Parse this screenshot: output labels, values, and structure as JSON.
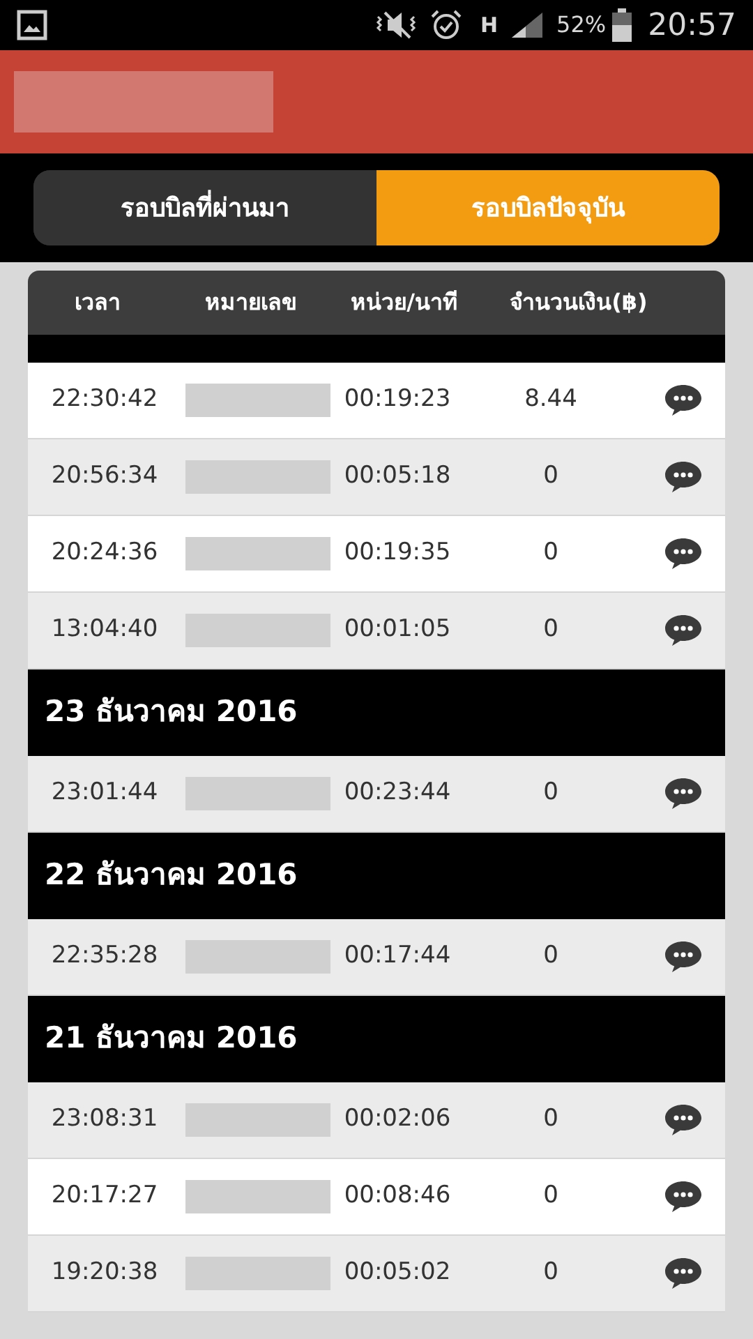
{
  "status_bar": {
    "network": "H",
    "battery": "52%",
    "time": "20:57"
  },
  "tabs": [
    {
      "label": "รอบบิลที่ผ่านมา",
      "selected": false
    },
    {
      "label": "รอบบิลปัจจุบัน",
      "selected": true
    }
  ],
  "table": {
    "columns": [
      "เวลา",
      "หมายเลข",
      "หน่วย/นาที",
      "จำนวนเงิน(฿)"
    ],
    "groups": [
      {
        "rows": [
          {
            "time": "22:30:42",
            "duration": "00:19:23",
            "amount": "8.44",
            "shaded": false
          },
          {
            "time": "20:56:34",
            "duration": "00:05:18",
            "amount": "0",
            "shaded": true
          },
          {
            "time": "20:24:36",
            "duration": "00:19:35",
            "amount": "0",
            "shaded": false
          },
          {
            "time": "13:04:40",
            "duration": "00:01:05",
            "amount": "0",
            "shaded": true
          }
        ]
      },
      {
        "date": "23 ธันวาคม 2016",
        "rows": [
          {
            "time": "23:01:44",
            "duration": "00:23:44",
            "amount": "0",
            "shaded": true
          }
        ]
      },
      {
        "date": "22 ธันวาคม 2016",
        "rows": [
          {
            "time": "22:35:28",
            "duration": "00:17:44",
            "amount": "0",
            "shaded": true
          }
        ]
      },
      {
        "date": "21 ธันวาคม 2016",
        "rows": [
          {
            "time": "23:08:31",
            "duration": "00:02:06",
            "amount": "0",
            "shaded": true
          },
          {
            "time": "20:17:27",
            "duration": "00:08:46",
            "amount": "0",
            "shaded": false
          },
          {
            "time": "19:20:38",
            "duration": "00:05:02",
            "amount": "0",
            "shaded": true
          }
        ]
      }
    ]
  }
}
